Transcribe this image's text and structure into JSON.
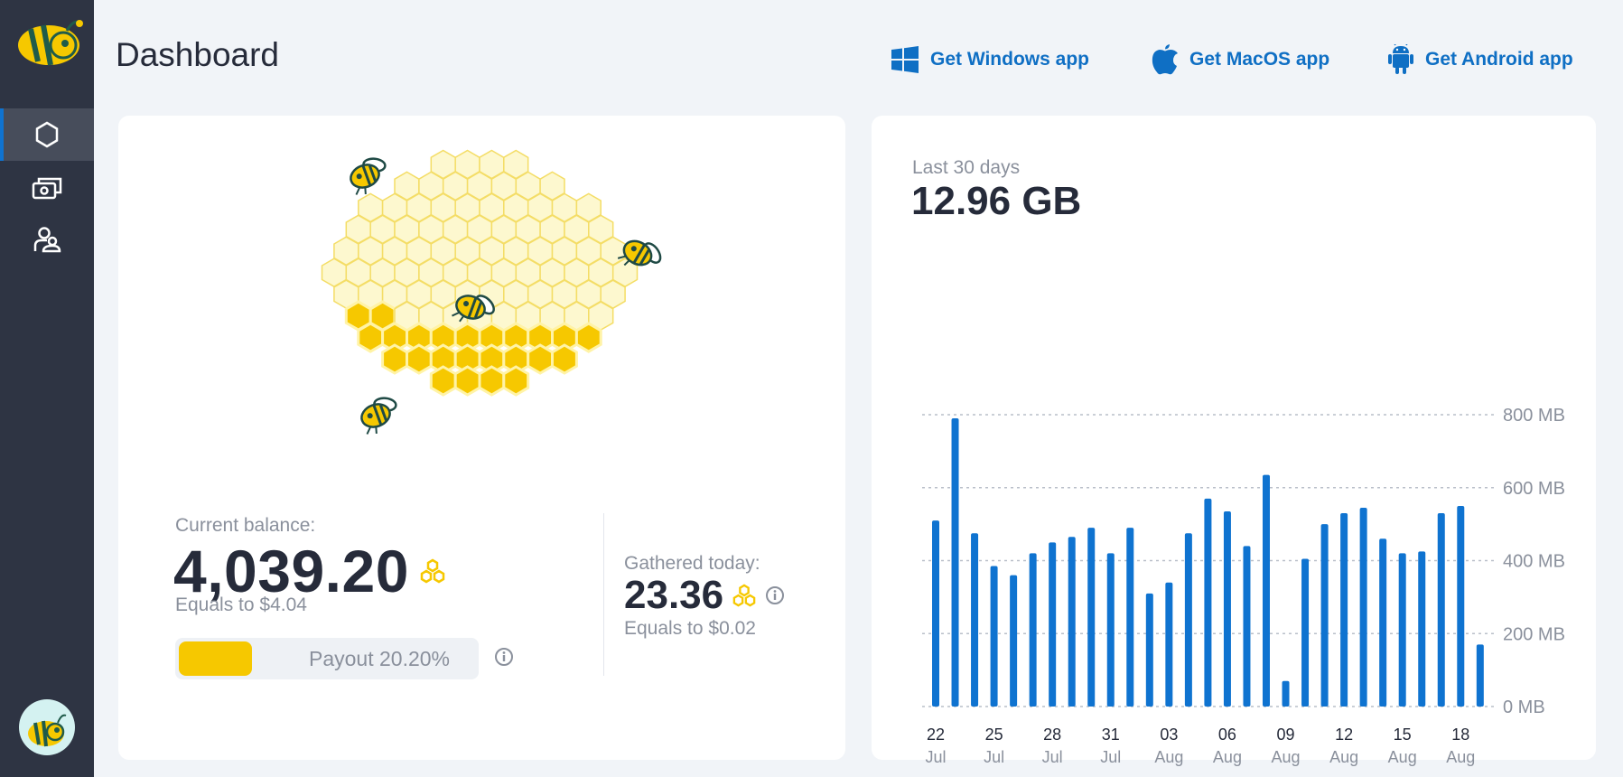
{
  "header": {
    "title": "Dashboard",
    "apps": [
      {
        "label": "Get Windows app",
        "icon": "windows-icon"
      },
      {
        "label": "Get MacOS app",
        "icon": "apple-icon"
      },
      {
        "label": "Get Android app",
        "icon": "android-icon"
      }
    ]
  },
  "sidebar": {
    "items": [
      {
        "icon": "hexagon-icon",
        "active": true
      },
      {
        "icon": "money-icon",
        "active": false
      },
      {
        "icon": "users-icon",
        "active": false
      }
    ]
  },
  "balance": {
    "label": "Current balance:",
    "value": "4,039.20",
    "equals": "Equals to $4.04",
    "payout_text": "Payout 20.20%",
    "payout_fraction": 0.202
  },
  "gathered": {
    "label": "Gathered today:",
    "value": "23.36",
    "equals": "Equals to $0.02"
  },
  "traffic": {
    "period_label": "Last 30 days",
    "total": "12.96 GB"
  },
  "colors": {
    "accent": "#0f6fc4",
    "bar": "#0f73d0",
    "honey": "#f6c800",
    "sidebar": "#2e3443"
  },
  "chart_data": {
    "type": "bar",
    "y_unit": "MB",
    "ylim": [
      0,
      800
    ],
    "y_ticks": [
      {
        "value": 800,
        "label": "800 MB"
      },
      {
        "value": 600,
        "label": "600 MB"
      },
      {
        "value": 400,
        "label": "400 MB"
      },
      {
        "value": 200,
        "label": "200 MB"
      },
      {
        "value": 0,
        "label": "0 MB"
      }
    ],
    "x_ticks": [
      {
        "index": 0,
        "day": "22",
        "month": "Jul"
      },
      {
        "index": 3,
        "day": "25",
        "month": "Jul"
      },
      {
        "index": 6,
        "day": "28",
        "month": "Jul"
      },
      {
        "index": 9,
        "day": "31",
        "month": "Jul"
      },
      {
        "index": 12,
        "day": "03",
        "month": "Aug"
      },
      {
        "index": 15,
        "day": "06",
        "month": "Aug"
      },
      {
        "index": 18,
        "day": "09",
        "month": "Aug"
      },
      {
        "index": 21,
        "day": "12",
        "month": "Aug"
      },
      {
        "index": 24,
        "day": "15",
        "month": "Aug"
      },
      {
        "index": 27,
        "day": "18",
        "month": "Aug"
      }
    ],
    "categories": [
      "22 Jul",
      "23 Jul",
      "24 Jul",
      "25 Jul",
      "26 Jul",
      "27 Jul",
      "28 Jul",
      "29 Jul",
      "30 Jul",
      "31 Jul",
      "01 Aug",
      "02 Aug",
      "03 Aug",
      "04 Aug",
      "05 Aug",
      "06 Aug",
      "07 Aug",
      "08 Aug",
      "09 Aug",
      "10 Aug",
      "11 Aug",
      "12 Aug",
      "13 Aug",
      "14 Aug",
      "15 Aug",
      "16 Aug",
      "17 Aug",
      "18 Aug",
      "19 Aug"
    ],
    "values": [
      510,
      790,
      475,
      385,
      360,
      420,
      450,
      465,
      490,
      420,
      490,
      310,
      340,
      475,
      570,
      535,
      440,
      635,
      70,
      405,
      500,
      530,
      545,
      460,
      420,
      425,
      530,
      550,
      170
    ],
    "grid": true
  }
}
